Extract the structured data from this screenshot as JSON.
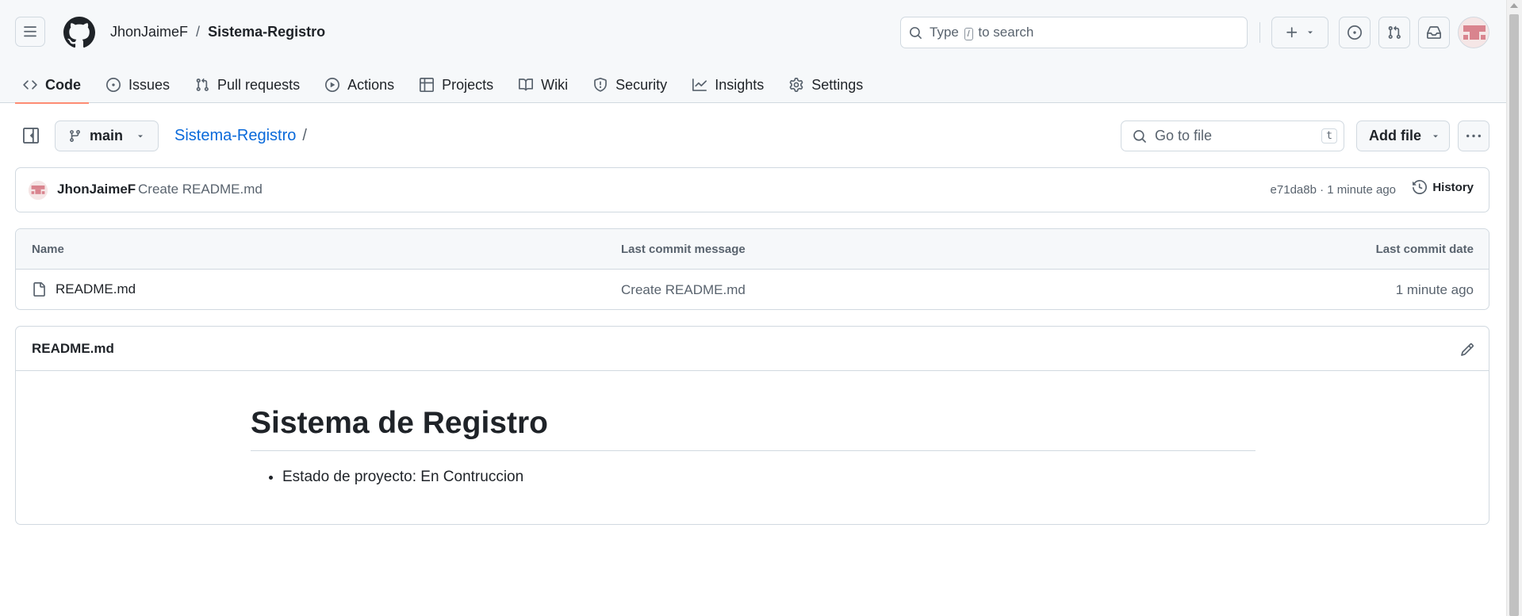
{
  "header": {
    "owner": "JhonJaimeF",
    "separator": "/",
    "repo": "Sistema-Registro",
    "search_before": "Type",
    "search_key": "/",
    "search_after": "to search"
  },
  "tabs": [
    {
      "label": "Code",
      "icon": "code-icon"
    },
    {
      "label": "Issues",
      "icon": "issue-icon"
    },
    {
      "label": "Pull requests",
      "icon": "pull-request-icon"
    },
    {
      "label": "Actions",
      "icon": "play-icon"
    },
    {
      "label": "Projects",
      "icon": "table-icon"
    },
    {
      "label": "Wiki",
      "icon": "book-icon"
    },
    {
      "label": "Security",
      "icon": "shield-icon"
    },
    {
      "label": "Insights",
      "icon": "graph-icon"
    },
    {
      "label": "Settings",
      "icon": "gear-icon"
    }
  ],
  "toolbar": {
    "branch": "main",
    "repo_link": "Sistema-Registro",
    "path_sep": "/",
    "goto_placeholder": "Go to file",
    "goto_key": "t",
    "add_file": "Add file"
  },
  "commit": {
    "author": "JhonJaimeF",
    "message": "Create README.md",
    "meta": "e71da8b · 1 minute ago",
    "history": "History"
  },
  "files": {
    "headers": {
      "name": "Name",
      "message": "Last commit message",
      "date": "Last commit date"
    },
    "rows": [
      {
        "name": "README.md",
        "message": "Create README.md",
        "date": "1 minute ago"
      }
    ]
  },
  "readme": {
    "title": "README.md",
    "h1": "Sistema de Registro",
    "items": [
      "Estado de proyecto: En Contruccion"
    ]
  },
  "colors": {
    "accent_tab": "#fd8c73",
    "link": "#0969da",
    "muted": "#59636e",
    "border": "#d1d9e0",
    "header_bg": "#f6f8fa"
  }
}
